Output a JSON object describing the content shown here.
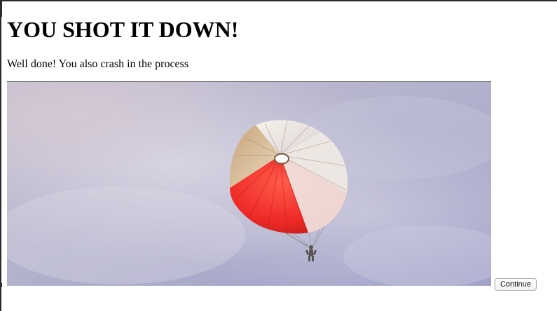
{
  "heading": "YOU SHOT IT DOWN!",
  "message": "Well done! You also crash in the process",
  "image": {
    "icon": "parachute-image",
    "sky_color": "#aeb0cf",
    "canopy_red": "#ef2f2a",
    "canopy_white": "#f4efe8"
  },
  "continue_label": "Continue"
}
